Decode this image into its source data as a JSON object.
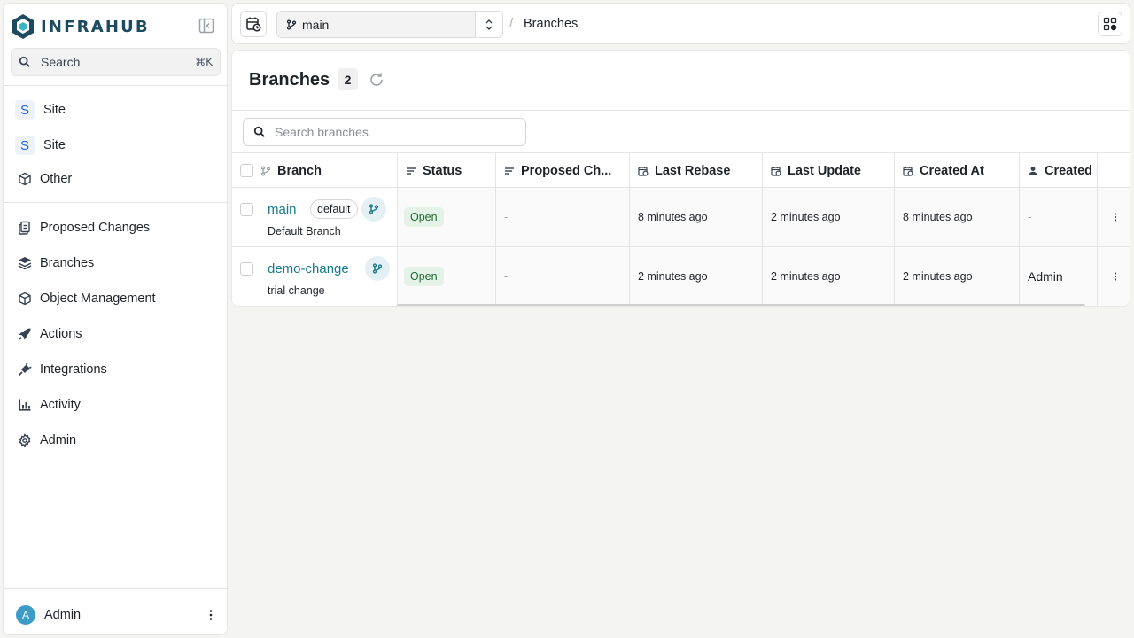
{
  "app": {
    "name": "INFRAHUB"
  },
  "colors": {
    "accent": "#167a8b",
    "logo": "#1c4b5f",
    "open_badge_bg": "#e4f2e7",
    "open_badge_fg": "#1f6b34",
    "avatar": "#3b9cc7"
  },
  "sidebar": {
    "search": {
      "label": "Search",
      "shortcut": "⌘K"
    },
    "pinned": [
      {
        "badge": "S",
        "label": "Site"
      },
      {
        "badge": "S",
        "label": "Site"
      },
      {
        "icon": "cube-icon",
        "label": "Other"
      }
    ],
    "nav": [
      {
        "icon": "proposed-changes-icon",
        "label": "Proposed Changes"
      },
      {
        "icon": "layers-icon",
        "label": "Branches"
      },
      {
        "icon": "cube-icon",
        "label": "Object Management"
      },
      {
        "icon": "rocket-icon",
        "label": "Actions"
      },
      {
        "icon": "plug-icon",
        "label": "Integrations"
      },
      {
        "icon": "activity-chart-icon",
        "label": "Activity"
      },
      {
        "icon": "gear-icon",
        "label": "Admin"
      }
    ],
    "user": {
      "initial": "A",
      "name": "Admin"
    }
  },
  "topbar": {
    "branch": "main",
    "breadcrumb_sep": "/",
    "breadcrumb": "Branches"
  },
  "page": {
    "title": "Branches",
    "count": "2",
    "search_placeholder": "Search branches"
  },
  "table": {
    "columns": [
      "Branch",
      "Status",
      "Proposed Ch...",
      "Last Rebase",
      "Last Update",
      "Created At",
      "Created I"
    ],
    "rows": [
      {
        "name": "main",
        "default_label": "default",
        "description": "Default Branch",
        "status": "Open",
        "proposed_changes": "-",
        "last_rebase": "8 minutes ago",
        "last_update": "2 minutes ago",
        "created_at": "8 minutes ago",
        "created_by": "-"
      },
      {
        "name": "demo-change",
        "description": "trial change",
        "status": "Open",
        "proposed_changes": "-",
        "last_rebase": "2 minutes ago",
        "last_update": "2 minutes ago",
        "created_at": "2 minutes ago",
        "created_by": "Admin"
      }
    ]
  }
}
